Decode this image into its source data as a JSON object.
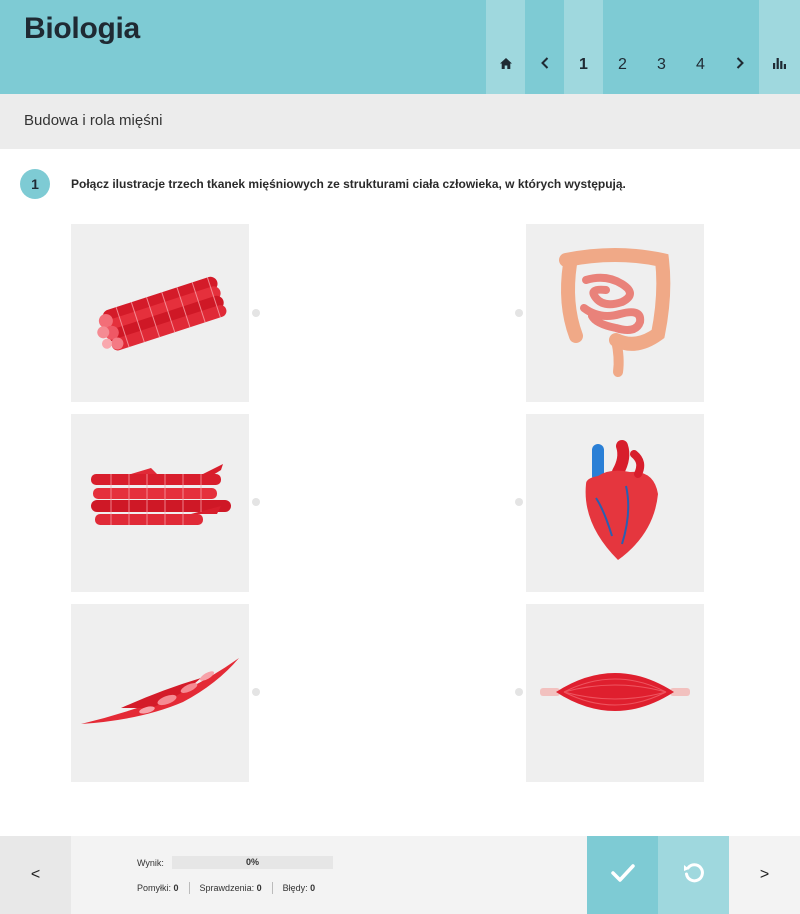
{
  "header": {
    "title": "Biologia",
    "nav": {
      "home_icon": "home-icon",
      "prev_label": "‹",
      "pages": [
        "1",
        "2",
        "3",
        "4"
      ],
      "active_page": "1",
      "next_label": "›",
      "stats_icon": "bar-chart-icon"
    }
  },
  "section": {
    "title": "Budowa i rola mięśni"
  },
  "task": {
    "number": "1",
    "instruction": "Połącz ilustracje trzech tkanek mięśniowych ze strukturami ciała człowieka, w których występują."
  },
  "tiles": {
    "left": [
      "skeletal-muscle-fibers-image",
      "cardiac-muscle-tissue-image",
      "smooth-muscle-cells-image"
    ],
    "right": [
      "intestines-image",
      "heart-image",
      "skeletal-muscle-image"
    ]
  },
  "footer": {
    "prev_label": "<",
    "next_label": ">",
    "score_label": "Wynik:",
    "score_value": "0%",
    "score_fraction": 0,
    "mistakes_label": "Pomyłki:",
    "mistakes_value": "0",
    "checks_label": "Sprawdzenia:",
    "checks_value": "0",
    "errors_label": "Błędy:",
    "errors_value": "0"
  },
  "colors": {
    "accent": "#7ecbd4",
    "accent_light": "#9fd8de",
    "tile_bg": "#efefef",
    "muscle_red": "#e0222e"
  }
}
